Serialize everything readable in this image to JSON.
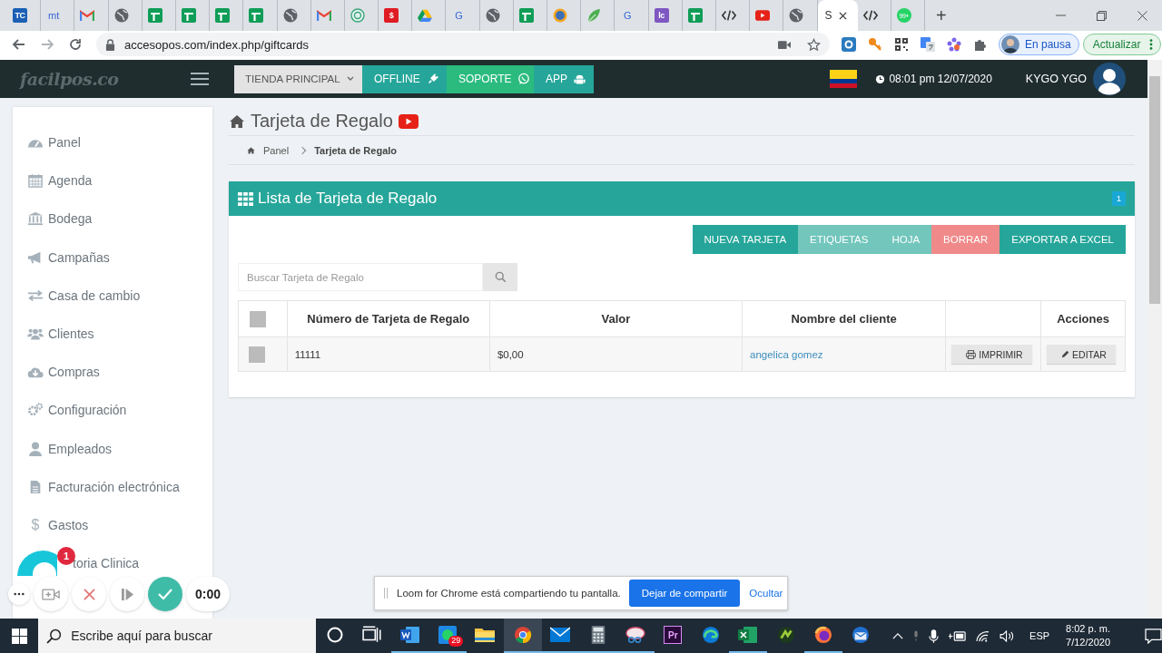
{
  "browser": {
    "tabs": [
      {
        "kind": "square",
        "color": "#1a5fb4",
        "mark": "TC",
        "selected": false
      },
      {
        "kind": "text",
        "mark": "mt",
        "selected": false
      },
      {
        "kind": "gmail",
        "selected": false
      },
      {
        "kind": "globe",
        "selected": false
      },
      {
        "kind": "sheets",
        "selected": false
      },
      {
        "kind": "sheets",
        "selected": false
      },
      {
        "kind": "sheets",
        "selected": false
      },
      {
        "kind": "sheets",
        "selected": false
      },
      {
        "kind": "globe",
        "selected": false
      },
      {
        "kind": "gmail",
        "selected": false
      },
      {
        "kind": "ring",
        "selected": false
      },
      {
        "kind": "square",
        "color": "#e01b24",
        "mark": "$",
        "selected": false
      },
      {
        "kind": "drive",
        "selected": false
      },
      {
        "kind": "text",
        "mark": "G",
        "selected": false
      },
      {
        "kind": "globe",
        "selected": false
      },
      {
        "kind": "sheets",
        "selected": false
      },
      {
        "kind": "coin",
        "selected": false
      },
      {
        "kind": "leaf",
        "selected": false
      },
      {
        "kind": "text",
        "mark": "G",
        "selected": false
      },
      {
        "kind": "square",
        "color": "#7e57c2",
        "mark": "lc",
        "selected": false
      },
      {
        "kind": "sheets",
        "selected": false
      },
      {
        "kind": "code",
        "selected": false
      },
      {
        "kind": "youtube",
        "selected": false
      },
      {
        "kind": "globe",
        "selected": false
      },
      {
        "kind": "none",
        "title": "S",
        "selected": true
      },
      {
        "kind": "code",
        "selected": false
      },
      {
        "kind": "chat",
        "mark": "99+",
        "selected": false
      }
    ],
    "new_tab": "+",
    "address": "accesopos.com/index.php/giftcards",
    "profile": "En pausa",
    "update_button": "Actualizar"
  },
  "app": {
    "logo": "facilpos.co",
    "nav": [
      {
        "label": "TIENDA PRINCIPAL",
        "kind": "dropdown"
      },
      {
        "label": "OFFLINE",
        "kind": "plug"
      },
      {
        "label": "SOPORTE",
        "kind": "whatsapp"
      },
      {
        "label": "APP",
        "kind": "android"
      }
    ],
    "clock": "08:01 pm 12/07/2020",
    "user": "KYGO YGO"
  },
  "sidebar": {
    "items": [
      {
        "label": "Panel",
        "kind": "gauge"
      },
      {
        "label": "Agenda",
        "kind": "calendar"
      },
      {
        "label": "Bodega",
        "kind": "bank"
      },
      {
        "label": "Campañas",
        "kind": "megaphone"
      },
      {
        "label": "Casa de cambio",
        "kind": "exchange"
      },
      {
        "label": "Clientes",
        "kind": "users"
      },
      {
        "label": "Compras",
        "kind": "cloud"
      },
      {
        "label": "Configuración",
        "kind": "cogs"
      },
      {
        "label": "Empleados",
        "kind": "user"
      },
      {
        "label": "Facturación electrónica",
        "kind": "file"
      },
      {
        "label": "Gastos",
        "kind": "glyph",
        "glyph": "$"
      },
      {
        "label": "toria Clinica",
        "kind": "hidden"
      }
    ]
  },
  "page": {
    "title": "Tarjeta de Regalo",
    "breadcrumb": [
      "Panel",
      "Tarjeta de Regalo"
    ],
    "panel": {
      "title": "Lista de Tarjeta de Regalo",
      "badge": "1",
      "buttons": [
        {
          "label": "NUEVA TARJETA",
          "color": "#26a69a"
        },
        {
          "label": "ETIQUETAS",
          "color": "#72c6bc"
        },
        {
          "label": "HOJA",
          "color": "#72c6bc"
        },
        {
          "label": "BORRAR",
          "color": "#f08a8a"
        },
        {
          "label": "EXPORTAR A EXCEL",
          "color": "#26a69a"
        }
      ],
      "search": {
        "placeholder": "Buscar Tarjeta de Regalo"
      },
      "table": {
        "columns": [
          {
            "kind": "check",
            "checked": false
          },
          {
            "kind": "text",
            "label": "Número de Tarjeta de Regalo"
          },
          {
            "kind": "text",
            "label": "Valor"
          },
          {
            "kind": "text",
            "label": "Nombre del cliente"
          },
          {
            "kind": "blank"
          },
          {
            "kind": "text",
            "label": "Acciones"
          }
        ],
        "rows": [
          {
            "checked": false,
            "number": "11111",
            "value": "$0,00",
            "client": "angelica gomez",
            "print": "IMPRIMIR",
            "edit": "EDITAR"
          }
        ]
      }
    }
  },
  "loom": {
    "notifications": "1",
    "timer": "0:00",
    "banner": {
      "text": "Loom for Chrome está compartiendo tu pantalla.",
      "button": "Dejar de compartir",
      "link": "Ocultar"
    }
  },
  "taskbar": {
    "search": {
      "placeholder": "Escribe aquí para buscar"
    },
    "apps": [
      {
        "kind": "cortana",
        "running": false,
        "selected": false
      },
      {
        "kind": "taskview",
        "running": false,
        "selected": false
      },
      {
        "kind": "word",
        "running": true,
        "selected": false
      },
      {
        "kind": "whatsapp",
        "badge": "29",
        "running": true,
        "selected": false
      },
      {
        "kind": "folder",
        "running": false,
        "selected": false
      },
      {
        "kind": "chrome",
        "running": true,
        "selected": true
      },
      {
        "kind": "mail",
        "running": true,
        "selected": false
      },
      {
        "kind": "calculator",
        "running": true,
        "selected": false
      },
      {
        "kind": "snip",
        "running": true,
        "selected": false
      },
      {
        "kind": "premiere",
        "mark": "Pr",
        "running": false,
        "selected": false
      },
      {
        "kind": "edge",
        "running": false,
        "selected": false
      },
      {
        "kind": "excel",
        "running": true,
        "selected": false
      },
      {
        "kind": "greenapp",
        "running": false,
        "selected": false
      },
      {
        "kind": "firefox",
        "running": true,
        "selected": false
      },
      {
        "kind": "thunderbird",
        "running": false,
        "selected": false
      }
    ],
    "tray": {
      "language": "ESP",
      "time": "8:02 p. m.",
      "date": "7/12/2020"
    }
  }
}
